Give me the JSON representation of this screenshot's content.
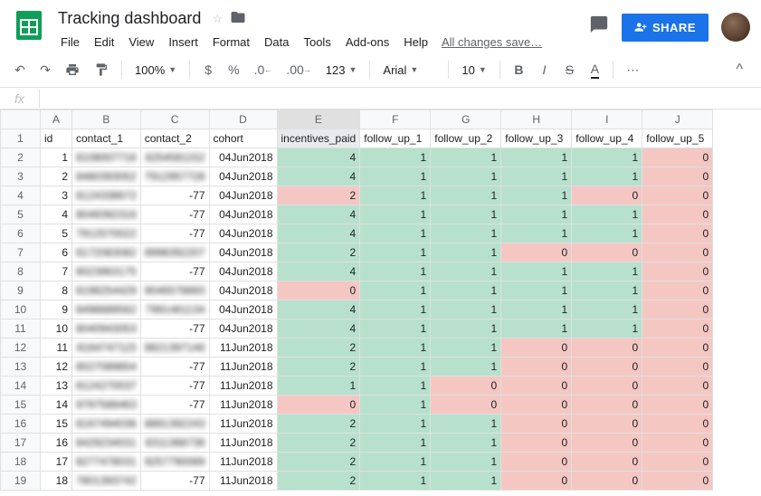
{
  "doc_title": "Tracking dashboard",
  "menus": [
    "File",
    "Edit",
    "View",
    "Insert",
    "Format",
    "Data",
    "Tools",
    "Add-ons",
    "Help"
  ],
  "save_status": "All changes save…",
  "share_label": "SHARE",
  "toolbar": {
    "zoom": "100%",
    "font": "Arial",
    "font_size": "10",
    "num_fmt": "123"
  },
  "columns": [
    "A",
    "B",
    "C",
    "D",
    "E",
    "F",
    "G",
    "H",
    "I",
    "J"
  ],
  "headers": [
    "id",
    "contact_1",
    "contact_2",
    "cohort",
    "incentives_paid",
    "follow_up_1",
    "follow_up_2",
    "follow_up_3",
    "follow_up_4",
    "follow_up_5"
  ],
  "selected_col": 4,
  "rows": [
    {
      "n": 2,
      "id": 1,
      "c1": "8108007716",
      "c2": "8254581152",
      "coh": "04Jun2018",
      "inc": 4,
      "f": [
        1,
        1,
        1,
        1,
        0
      ]
    },
    {
      "n": 3,
      "id": 2,
      "c1": "8480393052",
      "c2": "7912957728",
      "coh": "04Jun2018",
      "inc": 4,
      "f": [
        1,
        1,
        1,
        1,
        0
      ]
    },
    {
      "n": 4,
      "id": 3,
      "c1": "8124338672",
      "c2": "-77",
      "coh": "04Jun2018",
      "inc": 2,
      "f": [
        1,
        1,
        1,
        0,
        0
      ],
      "inc_red": true,
      "f_red": [
        0,
        0,
        0,
        1,
        1
      ]
    },
    {
      "n": 5,
      "id": 4,
      "c1": "8049392316",
      "c2": "-77",
      "coh": "04Jun2018",
      "inc": 4,
      "f": [
        1,
        1,
        1,
        1,
        0
      ]
    },
    {
      "n": 6,
      "id": 5,
      "c1": "7912570022",
      "c2": "-77",
      "coh": "04Jun2018",
      "inc": 4,
      "f": [
        1,
        1,
        1,
        1,
        0
      ]
    },
    {
      "n": 7,
      "id": 6,
      "c1": "8172083082",
      "c2": "8998392207",
      "coh": "04Jun2018",
      "inc": 2,
      "f": [
        1,
        1,
        0,
        0,
        0
      ],
      "f_red": [
        0,
        0,
        1,
        1,
        1
      ]
    },
    {
      "n": 8,
      "id": 7,
      "c1": "8023963175",
      "c2": "-77",
      "coh": "04Jun2018",
      "inc": 4,
      "f": [
        1,
        1,
        1,
        1,
        0
      ]
    },
    {
      "n": 9,
      "id": 8,
      "c1": "8198254429",
      "c2": "9046578893",
      "coh": "04Jun2018",
      "inc": 0,
      "f": [
        1,
        1,
        1,
        1,
        0
      ],
      "inc_red": true
    },
    {
      "n": 10,
      "id": 9,
      "c1": "8498689562",
      "c2": "7991461134",
      "coh": "04Jun2018",
      "inc": 4,
      "f": [
        1,
        1,
        1,
        1,
        0
      ]
    },
    {
      "n": 11,
      "id": 10,
      "c1": "8040943053",
      "c2": "-77",
      "coh": "04Jun2018",
      "inc": 4,
      "f": [
        1,
        1,
        1,
        1,
        0
      ]
    },
    {
      "n": 12,
      "id": 11,
      "c1": "8164747115",
      "c2": "8821397146",
      "coh": "11Jun2018",
      "inc": 2,
      "f": [
        1,
        1,
        0,
        0,
        0
      ],
      "f_red": [
        0,
        0,
        1,
        1,
        1
      ]
    },
    {
      "n": 13,
      "id": 12,
      "c1": "8027089854",
      "c2": "-77",
      "coh": "11Jun2018",
      "inc": 2,
      "f": [
        1,
        1,
        0,
        0,
        0
      ],
      "f_red": [
        0,
        0,
        1,
        1,
        1
      ]
    },
    {
      "n": 14,
      "id": 13,
      "c1": "8124270037",
      "c2": "-77",
      "coh": "11Jun2018",
      "inc": 1,
      "f": [
        1,
        0,
        0,
        0,
        0
      ],
      "f_red": [
        0,
        1,
        1,
        1,
        1
      ]
    },
    {
      "n": 15,
      "id": 14,
      "c1": "9797588463",
      "c2": "-77",
      "coh": "11Jun2018",
      "inc": 0,
      "f": [
        1,
        0,
        0,
        0,
        0
      ],
      "inc_red": true,
      "f_red": [
        0,
        1,
        1,
        1,
        1
      ]
    },
    {
      "n": 16,
      "id": 15,
      "c1": "8167494036",
      "c2": "8891392243",
      "coh": "11Jun2018",
      "inc": 2,
      "f": [
        1,
        1,
        0,
        0,
        0
      ],
      "f_red": [
        0,
        0,
        1,
        1,
        1
      ]
    },
    {
      "n": 17,
      "id": 16,
      "c1": "8429234031",
      "c2": "8311368736",
      "coh": "11Jun2018",
      "inc": 2,
      "f": [
        1,
        1,
        0,
        0,
        0
      ],
      "f_red": [
        0,
        0,
        1,
        1,
        1
      ]
    },
    {
      "n": 18,
      "id": 17,
      "c1": "8277478031",
      "c2": "9257790089",
      "coh": "11Jun2018",
      "inc": 2,
      "f": [
        1,
        1,
        0,
        0,
        0
      ],
      "f_red": [
        0,
        0,
        1,
        1,
        1
      ]
    },
    {
      "n": 19,
      "id": 18,
      "c1": "7801393742",
      "c2": "-77",
      "coh": "11Jun2018",
      "inc": 2,
      "f": [
        1,
        1,
        0,
        0,
        0
      ],
      "f_red": [
        0,
        0,
        1,
        1,
        1
      ]
    }
  ]
}
